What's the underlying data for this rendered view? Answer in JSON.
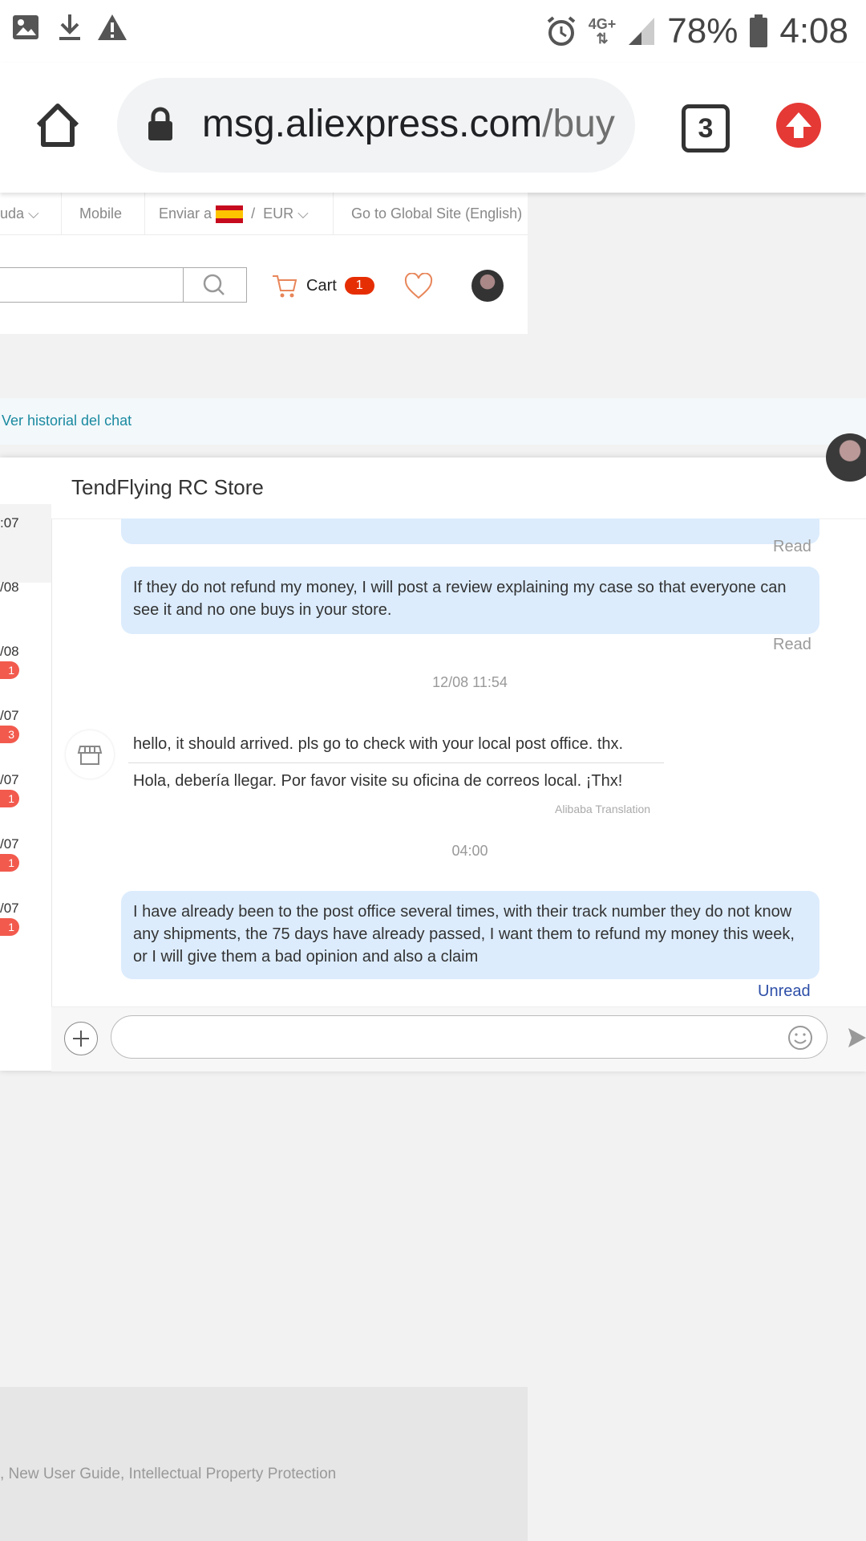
{
  "status_bar": {
    "battery": "78%",
    "time": "4:08",
    "network": "4G+"
  },
  "browser": {
    "url_host": "msg.aliexpress.com",
    "url_path": "/buy",
    "tab_count": "3"
  },
  "topnav": {
    "help": "uda",
    "mobile": "Mobile",
    "ship_to": "Enviar a",
    "separator": "/",
    "currency": "EUR",
    "global_site": "Go to Global Site (English)"
  },
  "header": {
    "cart_label": "Cart",
    "cart_count": "1"
  },
  "history_link": "Ver historial del chat",
  "chat": {
    "store_name": "TendFlying RC Store",
    "conversations": [
      {
        "date": ":07",
        "badge": ""
      },
      {
        "date": "/08",
        "badge": ""
      },
      {
        "date": "/08",
        "badge": "1"
      },
      {
        "date": "/07",
        "badge": "3"
      },
      {
        "date": "/07",
        "badge": "1"
      },
      {
        "date": "/07",
        "badge": "1"
      },
      {
        "date": "/07",
        "badge": "1"
      }
    ],
    "messages": {
      "top_partial_status": "Read",
      "msg1": "If they do not refund my money, I will post a review explaining my case so that everyone can see it and no one buys in your store.",
      "msg1_status": "Read",
      "ts1": "12/08 11:54",
      "reply_original": "hello, it should arrived. pls go to check with your local post office. thx.",
      "reply_translation": "Hola, debería llegar. Por favor visite su oficina de correos local. ¡Thx!",
      "translation_credit": "Alibaba Translation",
      "ts2": "04:00",
      "msg2": "I have already been to the post office several times, with their track number they do not know any shipments, the 75 days have already passed, I want them to refund my money this week, or I will give them a bad opinion and also a claim",
      "msg2_status": "Unread"
    },
    "input_placeholder": ""
  },
  "footer": {
    "links_text": ", New User Guide, Intellectual Property Protection"
  },
  "colors": {
    "bubble": "#dcecfd",
    "badge": "#f25a4d",
    "cart_badge": "#e62e04",
    "link": "#1a8aa0",
    "unread": "#2e4fa8"
  }
}
